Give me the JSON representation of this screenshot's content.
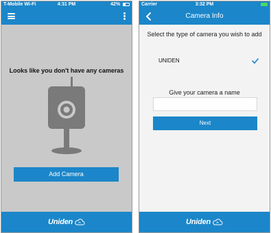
{
  "left_screen": {
    "status": {
      "carrier": "T-Mobile Wi-Fi",
      "time": "4:31 PM",
      "battery": "42%",
      "battery_level": 0.42
    },
    "icons": {
      "menu": "hamburger-menu-icon",
      "overflow": "more-vertical-icon",
      "camera": "camera-placeholder-icon"
    },
    "empty_message": "Looks like you don't have any cameras",
    "add_camera_label": "Add Camera",
    "brand": "Uniden"
  },
  "right_screen": {
    "status": {
      "carrier": "Carrier",
      "time": "3:32 PM",
      "battery_level": 1.0
    },
    "nav_title": "Camera Info",
    "select_prompt": "Select the type of camera you wish to add",
    "camera_type": "UNIDEN",
    "name_prompt": "Give your camera a name",
    "name_value": "",
    "next_label": "Next",
    "brand": "Uniden"
  },
  "colors": {
    "accent": "#1b86c9",
    "left_background": "#c9c9c9",
    "right_background": "#f3f3f3",
    "checkmark": "#1b86c9",
    "illustration": "#7a7a7a"
  }
}
